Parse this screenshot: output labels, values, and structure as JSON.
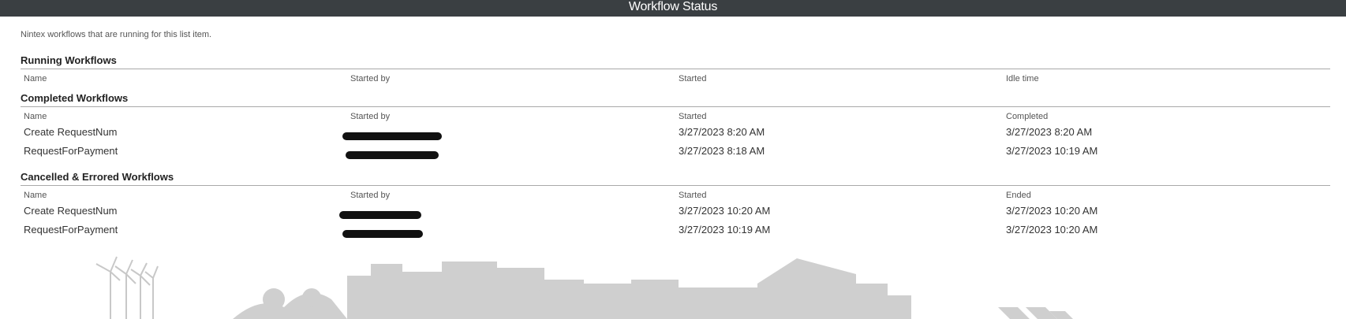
{
  "window": {
    "title": "Workflow Status"
  },
  "description": "Nintex workflows that are running for this list item.",
  "sections": {
    "running": {
      "title": "Running Workflows",
      "columns": [
        "Name",
        "Started by",
        "Started",
        "Idle time"
      ],
      "rows": []
    },
    "completed": {
      "title": "Completed Workflows",
      "columns": [
        "Name",
        "Started by",
        "Started",
        "Completed"
      ],
      "rows": [
        {
          "name": "Create RequestNum",
          "started": "3/27/2023 8:20 AM",
          "end": "3/27/2023 8:20 AM"
        },
        {
          "name": "RequestForPayment",
          "started": "3/27/2023 8:18 AM",
          "end": "3/27/2023 10:19 AM"
        }
      ]
    },
    "cancelled": {
      "title": "Cancelled & Errored Workflows",
      "columns": [
        "Name",
        "Started by",
        "Started",
        "Ended"
      ],
      "rows": [
        {
          "name": "Create RequestNum",
          "started": "3/27/2023 10:20 AM",
          "end": "3/27/2023 10:20 AM"
        },
        {
          "name": "RequestForPayment",
          "started": "3/27/2023 10:19 AM",
          "end": "3/27/2023 10:20 AM"
        }
      ]
    }
  },
  "colors": {
    "titlebar_bg": "#3a3f42",
    "link": "#2c6eaf",
    "rule": "#a9a9a9",
    "skyline": "#cfcfcf"
  },
  "icons": {
    "started_by_value": "redacted-name",
    "background": "city-skyline-illustration"
  }
}
